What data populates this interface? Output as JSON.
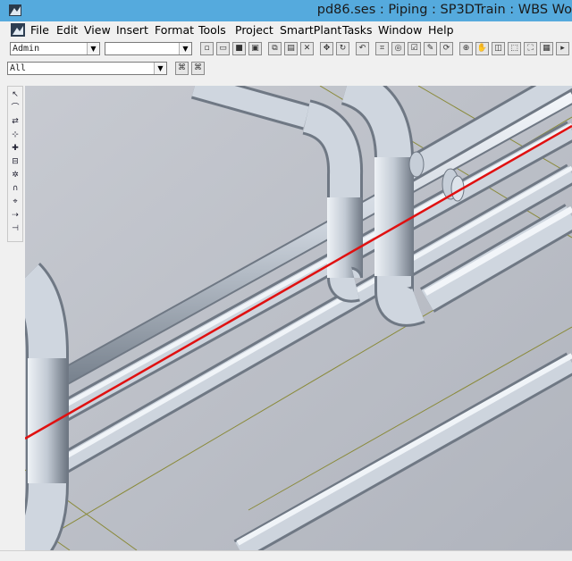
{
  "window": {
    "title": "pd86.ses : Piping : SP3DTrain : WBS Wo"
  },
  "menu": {
    "items": [
      "File",
      "Edit",
      "View",
      "Insert",
      "Format",
      "Tools",
      "Project",
      "SmartPlant",
      "Tasks",
      "Window",
      "Help"
    ]
  },
  "toolbar": {
    "permission_group": "Admin",
    "second_combo": "",
    "locate_filter": "All"
  },
  "icons": {
    "app": "sp3d-app-icon",
    "document": "session-document-icon",
    "toolbar": [
      "new-icon",
      "open-icon",
      "save-icon",
      "print-icon",
      "copy-icon",
      "paste-icon",
      "delete-icon",
      "move-icon",
      "rotate-icon",
      "undo-icon",
      "measure-icon",
      "inspect-icon",
      "properties-icon",
      "filter-icon",
      "refresh-icon",
      "zoom-icon",
      "pan-icon",
      "view-icon",
      "clip-icon",
      "render-icon",
      "grid-icon",
      "more-icon"
    ],
    "sidebar": [
      "select-icon",
      "route-pipe-icon",
      "insert-component-icon",
      "place-nozzle-icon",
      "connect-icon",
      "place-support-icon",
      "insert-split-icon",
      "place-elbow-icon",
      "select-run-icon",
      "tap-icon",
      "place-tag-icon"
    ]
  },
  "colors": {
    "titlebar": "#55aadd",
    "viewport_background": "#b9bcc4",
    "pipe": "#c4ccd6",
    "pipe_shadow": "#7d8794",
    "grid_line": "#8a8a3a",
    "highlight_line": "#e01010"
  }
}
